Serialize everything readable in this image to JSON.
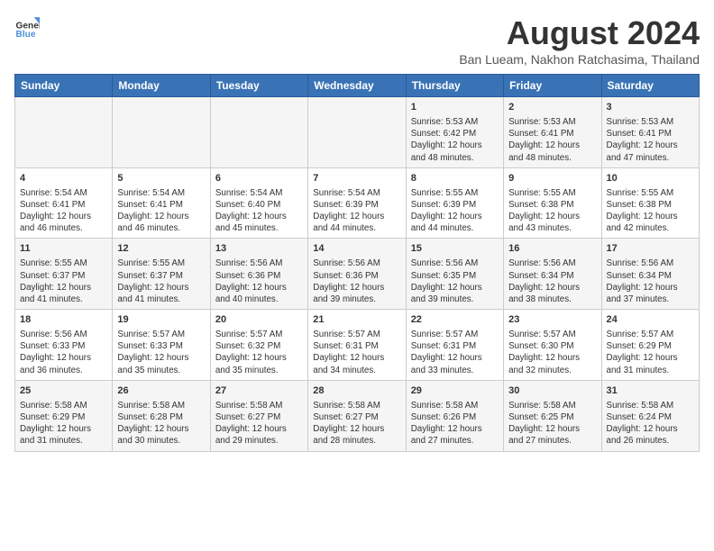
{
  "header": {
    "logo_line1": "General",
    "logo_line2": "Blue",
    "title": "August 2024",
    "subtitle": "Ban Lueam, Nakhon Ratchasima, Thailand"
  },
  "days_of_week": [
    "Sunday",
    "Monday",
    "Tuesday",
    "Wednesday",
    "Thursday",
    "Friday",
    "Saturday"
  ],
  "weeks": [
    [
      {
        "day": "",
        "info": ""
      },
      {
        "day": "",
        "info": ""
      },
      {
        "day": "",
        "info": ""
      },
      {
        "day": "",
        "info": ""
      },
      {
        "day": "1",
        "info": "Sunrise: 5:53 AM\nSunset: 6:42 PM\nDaylight: 12 hours\nand 48 minutes."
      },
      {
        "day": "2",
        "info": "Sunrise: 5:53 AM\nSunset: 6:41 PM\nDaylight: 12 hours\nand 48 minutes."
      },
      {
        "day": "3",
        "info": "Sunrise: 5:53 AM\nSunset: 6:41 PM\nDaylight: 12 hours\nand 47 minutes."
      }
    ],
    [
      {
        "day": "4",
        "info": "Sunrise: 5:54 AM\nSunset: 6:41 PM\nDaylight: 12 hours\nand 46 minutes."
      },
      {
        "day": "5",
        "info": "Sunrise: 5:54 AM\nSunset: 6:41 PM\nDaylight: 12 hours\nand 46 minutes."
      },
      {
        "day": "6",
        "info": "Sunrise: 5:54 AM\nSunset: 6:40 PM\nDaylight: 12 hours\nand 45 minutes."
      },
      {
        "day": "7",
        "info": "Sunrise: 5:54 AM\nSunset: 6:39 PM\nDaylight: 12 hours\nand 44 minutes."
      },
      {
        "day": "8",
        "info": "Sunrise: 5:55 AM\nSunset: 6:39 PM\nDaylight: 12 hours\nand 44 minutes."
      },
      {
        "day": "9",
        "info": "Sunrise: 5:55 AM\nSunset: 6:38 PM\nDaylight: 12 hours\nand 43 minutes."
      },
      {
        "day": "10",
        "info": "Sunrise: 5:55 AM\nSunset: 6:38 PM\nDaylight: 12 hours\nand 42 minutes."
      }
    ],
    [
      {
        "day": "11",
        "info": "Sunrise: 5:55 AM\nSunset: 6:37 PM\nDaylight: 12 hours\nand 41 minutes."
      },
      {
        "day": "12",
        "info": "Sunrise: 5:55 AM\nSunset: 6:37 PM\nDaylight: 12 hours\nand 41 minutes."
      },
      {
        "day": "13",
        "info": "Sunrise: 5:56 AM\nSunset: 6:36 PM\nDaylight: 12 hours\nand 40 minutes."
      },
      {
        "day": "14",
        "info": "Sunrise: 5:56 AM\nSunset: 6:36 PM\nDaylight: 12 hours\nand 39 minutes."
      },
      {
        "day": "15",
        "info": "Sunrise: 5:56 AM\nSunset: 6:35 PM\nDaylight: 12 hours\nand 39 minutes."
      },
      {
        "day": "16",
        "info": "Sunrise: 5:56 AM\nSunset: 6:34 PM\nDaylight: 12 hours\nand 38 minutes."
      },
      {
        "day": "17",
        "info": "Sunrise: 5:56 AM\nSunset: 6:34 PM\nDaylight: 12 hours\nand 37 minutes."
      }
    ],
    [
      {
        "day": "18",
        "info": "Sunrise: 5:56 AM\nSunset: 6:33 PM\nDaylight: 12 hours\nand 36 minutes."
      },
      {
        "day": "19",
        "info": "Sunrise: 5:57 AM\nSunset: 6:33 PM\nDaylight: 12 hours\nand 35 minutes."
      },
      {
        "day": "20",
        "info": "Sunrise: 5:57 AM\nSunset: 6:32 PM\nDaylight: 12 hours\nand 35 minutes."
      },
      {
        "day": "21",
        "info": "Sunrise: 5:57 AM\nSunset: 6:31 PM\nDaylight: 12 hours\nand 34 minutes."
      },
      {
        "day": "22",
        "info": "Sunrise: 5:57 AM\nSunset: 6:31 PM\nDaylight: 12 hours\nand 33 minutes."
      },
      {
        "day": "23",
        "info": "Sunrise: 5:57 AM\nSunset: 6:30 PM\nDaylight: 12 hours\nand 32 minutes."
      },
      {
        "day": "24",
        "info": "Sunrise: 5:57 AM\nSunset: 6:29 PM\nDaylight: 12 hours\nand 31 minutes."
      }
    ],
    [
      {
        "day": "25",
        "info": "Sunrise: 5:58 AM\nSunset: 6:29 PM\nDaylight: 12 hours\nand 31 minutes."
      },
      {
        "day": "26",
        "info": "Sunrise: 5:58 AM\nSunset: 6:28 PM\nDaylight: 12 hours\nand 30 minutes."
      },
      {
        "day": "27",
        "info": "Sunrise: 5:58 AM\nSunset: 6:27 PM\nDaylight: 12 hours\nand 29 minutes."
      },
      {
        "day": "28",
        "info": "Sunrise: 5:58 AM\nSunset: 6:27 PM\nDaylight: 12 hours\nand 28 minutes."
      },
      {
        "day": "29",
        "info": "Sunrise: 5:58 AM\nSunset: 6:26 PM\nDaylight: 12 hours\nand 27 minutes."
      },
      {
        "day": "30",
        "info": "Sunrise: 5:58 AM\nSunset: 6:25 PM\nDaylight: 12 hours\nand 27 minutes."
      },
      {
        "day": "31",
        "info": "Sunrise: 5:58 AM\nSunset: 6:24 PM\nDaylight: 12 hours\nand 26 minutes."
      }
    ]
  ]
}
